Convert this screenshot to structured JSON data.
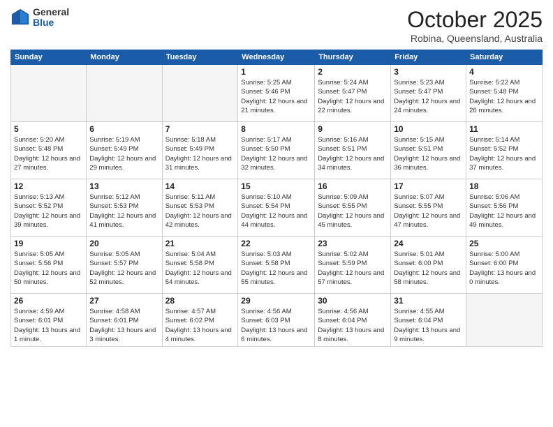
{
  "header": {
    "logo_general": "General",
    "logo_blue": "Blue",
    "month_title": "October 2025",
    "location": "Robina, Queensland, Australia"
  },
  "weekdays": [
    "Sunday",
    "Monday",
    "Tuesday",
    "Wednesday",
    "Thursday",
    "Friday",
    "Saturday"
  ],
  "weeks": [
    [
      {
        "day": "",
        "info": ""
      },
      {
        "day": "",
        "info": ""
      },
      {
        "day": "",
        "info": ""
      },
      {
        "day": "1",
        "info": "Sunrise: 5:25 AM\nSunset: 5:46 PM\nDaylight: 12 hours\nand 21 minutes."
      },
      {
        "day": "2",
        "info": "Sunrise: 5:24 AM\nSunset: 5:47 PM\nDaylight: 12 hours\nand 22 minutes."
      },
      {
        "day": "3",
        "info": "Sunrise: 5:23 AM\nSunset: 5:47 PM\nDaylight: 12 hours\nand 24 minutes."
      },
      {
        "day": "4",
        "info": "Sunrise: 5:22 AM\nSunset: 5:48 PM\nDaylight: 12 hours\nand 26 minutes."
      }
    ],
    [
      {
        "day": "5",
        "info": "Sunrise: 5:20 AM\nSunset: 5:48 PM\nDaylight: 12 hours\nand 27 minutes."
      },
      {
        "day": "6",
        "info": "Sunrise: 5:19 AM\nSunset: 5:49 PM\nDaylight: 12 hours\nand 29 minutes."
      },
      {
        "day": "7",
        "info": "Sunrise: 5:18 AM\nSunset: 5:49 PM\nDaylight: 12 hours\nand 31 minutes."
      },
      {
        "day": "8",
        "info": "Sunrise: 5:17 AM\nSunset: 5:50 PM\nDaylight: 12 hours\nand 32 minutes."
      },
      {
        "day": "9",
        "info": "Sunrise: 5:16 AM\nSunset: 5:51 PM\nDaylight: 12 hours\nand 34 minutes."
      },
      {
        "day": "10",
        "info": "Sunrise: 5:15 AM\nSunset: 5:51 PM\nDaylight: 12 hours\nand 36 minutes."
      },
      {
        "day": "11",
        "info": "Sunrise: 5:14 AM\nSunset: 5:52 PM\nDaylight: 12 hours\nand 37 minutes."
      }
    ],
    [
      {
        "day": "12",
        "info": "Sunrise: 5:13 AM\nSunset: 5:52 PM\nDaylight: 12 hours\nand 39 minutes."
      },
      {
        "day": "13",
        "info": "Sunrise: 5:12 AM\nSunset: 5:53 PM\nDaylight: 12 hours\nand 41 minutes."
      },
      {
        "day": "14",
        "info": "Sunrise: 5:11 AM\nSunset: 5:53 PM\nDaylight: 12 hours\nand 42 minutes."
      },
      {
        "day": "15",
        "info": "Sunrise: 5:10 AM\nSunset: 5:54 PM\nDaylight: 12 hours\nand 44 minutes."
      },
      {
        "day": "16",
        "info": "Sunrise: 5:09 AM\nSunset: 5:55 PM\nDaylight: 12 hours\nand 45 minutes."
      },
      {
        "day": "17",
        "info": "Sunrise: 5:07 AM\nSunset: 5:55 PM\nDaylight: 12 hours\nand 47 minutes."
      },
      {
        "day": "18",
        "info": "Sunrise: 5:06 AM\nSunset: 5:56 PM\nDaylight: 12 hours\nand 49 minutes."
      }
    ],
    [
      {
        "day": "19",
        "info": "Sunrise: 5:05 AM\nSunset: 5:56 PM\nDaylight: 12 hours\nand 50 minutes."
      },
      {
        "day": "20",
        "info": "Sunrise: 5:05 AM\nSunset: 5:57 PM\nDaylight: 12 hours\nand 52 minutes."
      },
      {
        "day": "21",
        "info": "Sunrise: 5:04 AM\nSunset: 5:58 PM\nDaylight: 12 hours\nand 54 minutes."
      },
      {
        "day": "22",
        "info": "Sunrise: 5:03 AM\nSunset: 5:58 PM\nDaylight: 12 hours\nand 55 minutes."
      },
      {
        "day": "23",
        "info": "Sunrise: 5:02 AM\nSunset: 5:59 PM\nDaylight: 12 hours\nand 57 minutes."
      },
      {
        "day": "24",
        "info": "Sunrise: 5:01 AM\nSunset: 6:00 PM\nDaylight: 12 hours\nand 58 minutes."
      },
      {
        "day": "25",
        "info": "Sunrise: 5:00 AM\nSunset: 6:00 PM\nDaylight: 13 hours\nand 0 minutes."
      }
    ],
    [
      {
        "day": "26",
        "info": "Sunrise: 4:59 AM\nSunset: 6:01 PM\nDaylight: 13 hours\nand 1 minute."
      },
      {
        "day": "27",
        "info": "Sunrise: 4:58 AM\nSunset: 6:01 PM\nDaylight: 13 hours\nand 3 minutes."
      },
      {
        "day": "28",
        "info": "Sunrise: 4:57 AM\nSunset: 6:02 PM\nDaylight: 13 hours\nand 4 minutes."
      },
      {
        "day": "29",
        "info": "Sunrise: 4:56 AM\nSunset: 6:03 PM\nDaylight: 13 hours\nand 6 minutes."
      },
      {
        "day": "30",
        "info": "Sunrise: 4:56 AM\nSunset: 6:04 PM\nDaylight: 13 hours\nand 8 minutes."
      },
      {
        "day": "31",
        "info": "Sunrise: 4:55 AM\nSunset: 6:04 PM\nDaylight: 13 hours\nand 9 minutes."
      },
      {
        "day": "",
        "info": ""
      }
    ]
  ]
}
